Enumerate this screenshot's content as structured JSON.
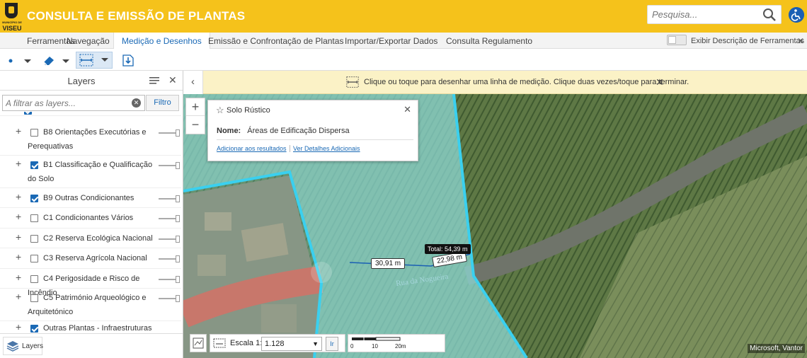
{
  "header": {
    "brand": "VISEU",
    "brand_sub": "MUNICÍPIO DE",
    "title": "CONSULTA E EMISSÃO DE PLANTAS",
    "search_placeholder": "Pesquisa...",
    "accent": "#f5c21b"
  },
  "tabs": [
    {
      "label": "Ferramentas"
    },
    {
      "label": "Navegação"
    },
    {
      "label": "Medição e Desenhos",
      "active": true
    },
    {
      "label": "Emissão e Confrontação de Plantas"
    },
    {
      "label": "Importar/Exportar Dados"
    },
    {
      "label": "Consulta Regulamento"
    }
  ],
  "toggle_label": "Exibir Descrição de Ferramentas",
  "layers_panel": {
    "title": "Layers",
    "filter_placeholder": "A filtrar as layers...",
    "filter_button": "Filtro",
    "items": [
      {
        "label": "B8 Orientações Executórias e Perequativas",
        "checked": false
      },
      {
        "label": "B1 Classificação e Qualificação do Solo",
        "checked": true
      },
      {
        "label": "B9 Outras Condicionantes",
        "checked": true
      },
      {
        "label": "C1 Condicionantes Vários",
        "checked": false
      },
      {
        "label": "C2 Reserva Ecológica Nacional",
        "checked": false
      },
      {
        "label": "C3 Reserva Agrícola Nacional",
        "checked": false
      },
      {
        "label": "C4 Perigosidade e Risco de Incêndio",
        "checked": false
      },
      {
        "label": "C5 Património Arqueológico e Arquitetónico",
        "checked": false
      },
      {
        "label": "Outras Plantas - Infraestruturas",
        "checked": true
      }
    ],
    "footer_tab": "Layers"
  },
  "notice": {
    "text": "Clique ou toque para desenhar uma linha de medição. Clique duas vezes/toque para terminar."
  },
  "popup": {
    "title": "Solo Rústico",
    "field_name": "Nome:",
    "field_value": "Áreas de Edificação Dispersa",
    "link_add": "Adicionar aos resultados",
    "link_details": "Ver Detalhes Adicionais"
  },
  "measurement": {
    "segment1": "30,91 m",
    "segment2": "22,98 m",
    "total": "Total: 54,39 m"
  },
  "map": {
    "street": "Rua da Nogueira",
    "attribution": "Microsoft, Vantor"
  },
  "scale": {
    "label": "Escala 1:",
    "value": "1.128",
    "go": "Ir",
    "bar_ticks": [
      "0",
      "10",
      "20m"
    ]
  }
}
